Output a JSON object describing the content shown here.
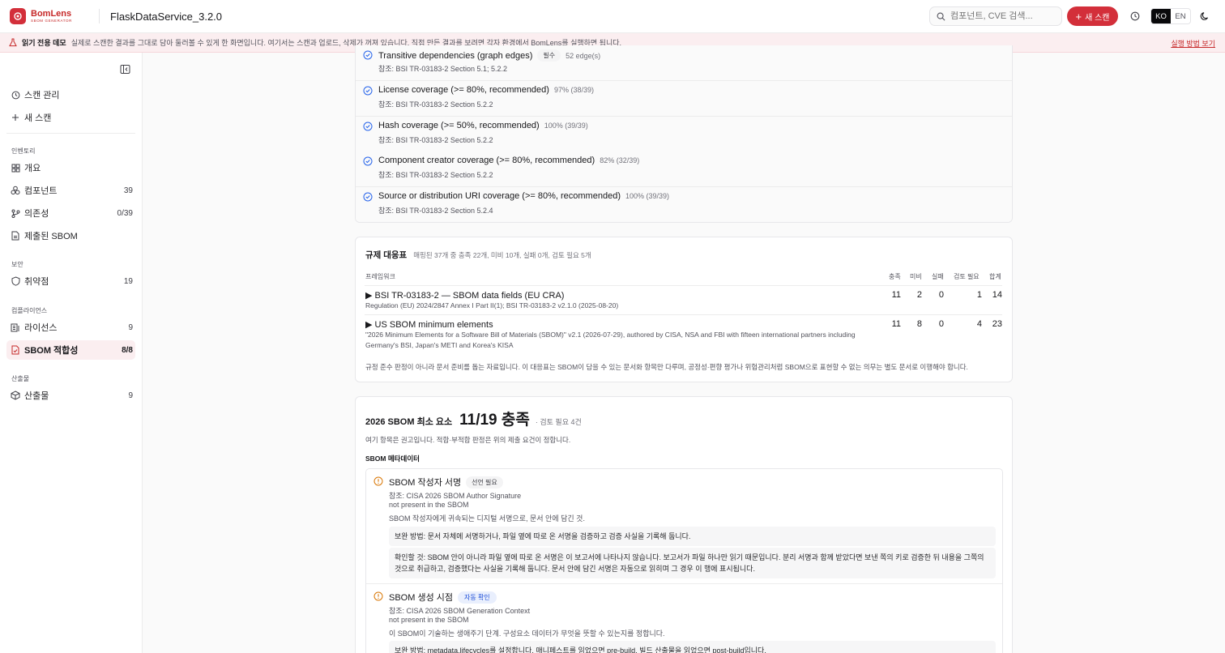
{
  "brand": {
    "name": "BomLens",
    "subtitle": "SBOM GENERATOR",
    "accent": "#d32f3a"
  },
  "header": {
    "project": "FlaskDataService_3.2.0",
    "search_placeholder": "컴포넌트, CVE 검색...",
    "new_scan_label": "새 스캔",
    "lang_ko": "KO",
    "lang_en": "EN"
  },
  "banner": {
    "title": "읽기 전용 데모",
    "text": "실제로 스캔한 결과를 그대로 담아 둘러볼 수 있게 한 화면입니다. 여기서는 스캔과 업로드, 삭제가 꺼져 있습니다. 직접 만든 결과를 보려면 각자 환경에서 BomLens를 실행하면 됩니다.",
    "link": "실행 방법 보기"
  },
  "sidebar": {
    "top_items": [
      {
        "label": "스캔 관리",
        "icon": "clock-icon"
      },
      {
        "label": "새 스캔",
        "icon": "plus-icon"
      }
    ],
    "sections": [
      {
        "title": "인벤토리",
        "items": [
          {
            "label": "개요",
            "count": "",
            "icon": "grid-icon"
          },
          {
            "label": "컴포넌트",
            "count": "39",
            "icon": "cubes-icon"
          },
          {
            "label": "의존성",
            "count": "0/39",
            "icon": "branch-icon"
          },
          {
            "label": "제출된 SBOM",
            "count": "",
            "icon": "file-icon"
          }
        ]
      },
      {
        "title": "보안",
        "items": [
          {
            "label": "취약점",
            "count": "19",
            "icon": "shield-icon"
          }
        ]
      },
      {
        "title": "컴플라이언스",
        "items": [
          {
            "label": "라이선스",
            "count": "9",
            "icon": "license-icon"
          },
          {
            "label": "SBOM 적합성",
            "count": "8/8",
            "icon": "file-check-icon",
            "active": true
          }
        ]
      },
      {
        "title": "산출물",
        "items": [
          {
            "label": "산출물",
            "count": "9",
            "icon": "box-icon"
          }
        ]
      }
    ]
  },
  "checks": [
    {
      "title": "Transitive dependencies (graph edges)",
      "badge": "필수",
      "meta": "52 edge(s)",
      "ref": "참조: BSI TR-03183-2 Section 5.1; 5.2.2"
    },
    {
      "title": "License coverage (>= 80%, recommended)",
      "badge": "",
      "meta": "97% (38/39)",
      "ref": "참조: BSI TR-03183-2 Section 5.2.2"
    },
    {
      "title": "Hash coverage (>= 50%, recommended)",
      "badge": "",
      "meta": "100% (39/39)",
      "ref": "참조: BSI TR-03183-2 Section 5.2.2"
    },
    {
      "title": "Component creator coverage (>= 80%, recommended)",
      "badge": "",
      "meta": "82% (32/39)",
      "ref": "참조: BSI TR-03183-2 Section 5.2.2"
    },
    {
      "title": "Source or distribution URI coverage (>= 80%, recommended)",
      "badge": "",
      "meta": "100% (39/39)",
      "ref": "참조: BSI TR-03183-2 Section 5.2.4"
    }
  ],
  "reg_table": {
    "title": "규제 대응표",
    "summary": "매핑된 37개 중 충족 22개, 미비 10개, 실패 0개, 검토 필요 5개",
    "columns": {
      "framework": "프레임워크",
      "met": "충족",
      "missing": "미비",
      "fail": "실패",
      "review": "검토 필요",
      "total": "합계"
    },
    "rows": [
      {
        "name": "▶ BSI TR-03183-2 — SBOM data fields (EU CRA)",
        "desc": "Regulation (EU) 2024/2847 Annex I Part II(1); BSI TR-03183-2 v2.1.0 (2025-08-20)",
        "met": "11",
        "missing": "2",
        "fail": "0",
        "review": "1",
        "total": "14"
      },
      {
        "name": "▶ US SBOM minimum elements",
        "desc": "\"2026 Minimum Elements for a Software Bill of Materials (SBOM)\" v2.1 (2026-07-29), authored by CISA, NSA and FBI with fifteen international partners including Germany's BSI, Japan's METI and Korea's KISA",
        "met": "11",
        "missing": "8",
        "fail": "0",
        "review": "4",
        "total": "23"
      }
    ],
    "note": "규정 준수 판정이 아니라 문서 준비를 돕는 자료입니다. 이 대응표는 SBOM이 담을 수 있는 문서화 항목만 다루며, 공정성·편향 평가나 위험관리처럼 SBOM으로 표현할 수 없는 의무는 별도 문서로 이행해야 합니다."
  },
  "min_elements": {
    "label": "2026 SBOM 최소 요소",
    "score": "11/19 충족",
    "review": "· 검토 필요 4건",
    "desc": "여기 항목은 권고입니다. 적합·부적합 판정은 위의 제출 요건이 정합니다.",
    "group": "SBOM 메타데이터",
    "items": [
      {
        "title": "SBOM 작성자 서명",
        "badge": "선언 필요",
        "badge_style": "gray",
        "ref": "참조: CISA 2026 SBOM Author Signature",
        "status": "not present in the SBOM",
        "detail": "SBOM 작성자에게 귀속되는 디지털 서명으로, 문서 안에 담긴 것.",
        "fix": "보완 방법: 문서 자체에 서명하거나, 파일 옆에 따로 온 서명을 검증하고 검증 사실을 기록해 둡니다.",
        "check": "확인할 것: SBOM 안이 아니라 파일 옆에 따로 온 서명은 이 보고서에 나타나지 않습니다. 보고서가 파일 하나만 읽기 때문입니다. 분리 서명과 함께 받았다면 보낸 쪽의 키로 검증한 뒤 내용을 그쪽의 것으로 취급하고, 검증했다는 사실을 기록해 둡니다. 문서 안에 담긴 서명은 자동으로 읽히며 그 경우 이 행에 표시됩니다."
      },
      {
        "title": "SBOM 생성 시점",
        "badge": "자동 확인",
        "badge_style": "blue",
        "ref": "참조: CISA 2026 SBOM Generation Context",
        "status": "not present in the SBOM",
        "detail": "이 SBOM이 기술하는 생애주기 단계. 구성요소 데이터가 무엇을 뜻할 수 있는지를 정합니다.",
        "fix": "보완 방법: metadata.lifecycles를 설정합니다. 매니페스트를 읽었으면 pre-build, 빌드 산출물을 읽었으면 post-build입니다."
      }
    ]
  }
}
